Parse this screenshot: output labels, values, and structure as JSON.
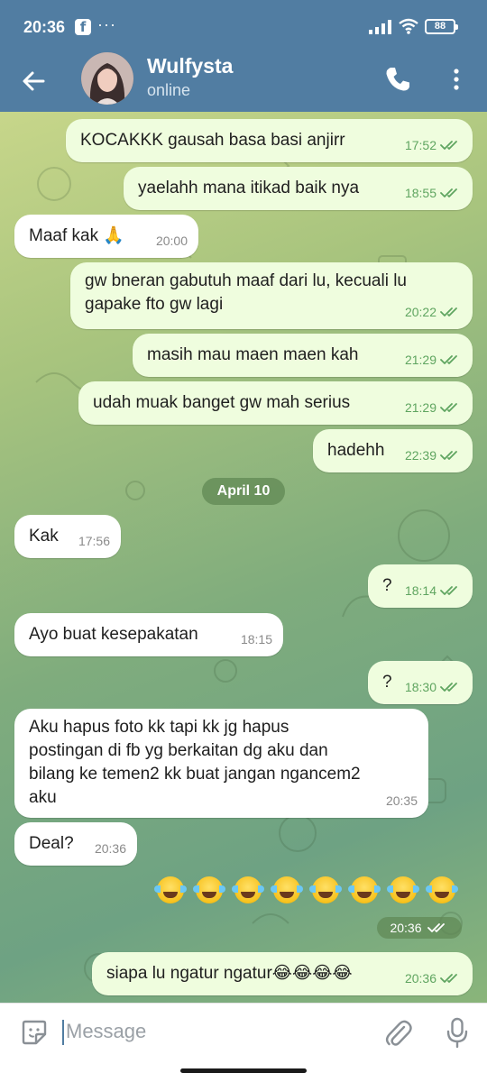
{
  "statusbar": {
    "time": "20:36",
    "fb_glyph": "f",
    "dots": "···",
    "battery": "88"
  },
  "header": {
    "title": "Wulfysta",
    "subtitle": "online",
    "back_icon": "arrow-left-icon",
    "call_icon": "phone-icon",
    "more_icon": "more-vertical-icon"
  },
  "messages": [
    {
      "dir": "out",
      "text": "KOCAKKK gausah basa basi anjirr",
      "time": "17:52"
    },
    {
      "dir": "out",
      "text": "yaelahh mana itikad baik nya",
      "time": "18:55"
    },
    {
      "dir": "in",
      "text": "Maaf kak 🙏",
      "time": "20:00"
    },
    {
      "dir": "out",
      "text": "gw bneran gabutuh maaf dari lu, kecuali lu\ngapake fto gw lagi",
      "time": "20:22"
    },
    {
      "dir": "out",
      "text": "masih mau maen maen kah",
      "time": "21:29"
    },
    {
      "dir": "out",
      "text": "udah muak banget gw mah serius",
      "time": "21:29"
    },
    {
      "dir": "out",
      "text": "hadehh",
      "time": "22:39"
    },
    {
      "dir": "in",
      "text": "Kak",
      "time": "17:56"
    },
    {
      "dir": "out",
      "text": "?",
      "time": "18:14"
    },
    {
      "dir": "in",
      "text": "Ayo buat kesepakatan",
      "time": "18:15"
    },
    {
      "dir": "out",
      "text": "?",
      "time": "18:30"
    },
    {
      "dir": "in",
      "text": "Aku hapus foto kk tapi kk jg hapus\npostingan di fb yg berkaitan dg aku dan\nbilang ke temen2 kk buat jangan ngancem2\naku",
      "time": "20:35"
    },
    {
      "dir": "in",
      "text": "Deal?",
      "time": "20:36"
    },
    {
      "dir": "out",
      "text": "siapa lu ngatur ngatur😂😂😂😂",
      "time": "20:36"
    }
  ],
  "date_separator": "April 10",
  "emoji_message": {
    "emoji": "face-with-tears-of-joy",
    "count": 8,
    "time": "20:36"
  },
  "input": {
    "placeholder": "Message",
    "sticker_icon": "sticker-icon",
    "attach_icon": "paperclip-icon",
    "mic_icon": "microphone-icon"
  },
  "colors": {
    "header": "#517da2",
    "outgoing_bubble": "#effdde",
    "incoming_bubble": "#ffffff",
    "read_ticks": "#5fa560"
  }
}
